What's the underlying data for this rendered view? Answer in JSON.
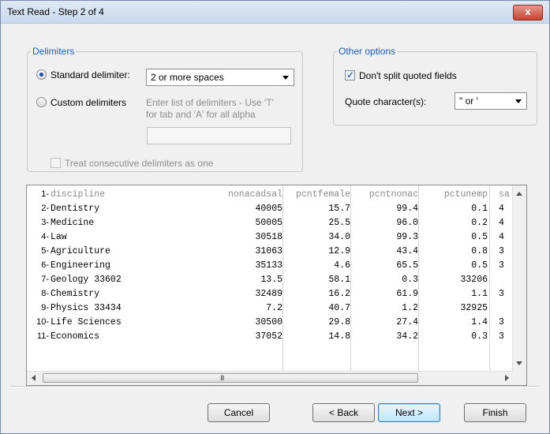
{
  "window": {
    "title": "Text Read - Step 2 of 4",
    "close_label": "x"
  },
  "delimiters": {
    "legend": "Delimiters",
    "standard_label": "Standard delimiter:",
    "standard_value": "2 or more spaces",
    "custom_label": "Custom delimiters",
    "custom_hint_line1": "Enter list of delimiters - Use 'T'",
    "custom_hint_line2": "for tab and 'A' for all alpha",
    "custom_value": "",
    "consecutive_label": "Treat consecutive delimiters as one"
  },
  "other_options": {
    "legend": "Other options",
    "dont_split_label": "Don't split quoted fields",
    "quote_label": "Quote character(s):",
    "quote_value": "\" or '"
  },
  "preview": {
    "row_numbers": [
      "1",
      "2",
      "3",
      "4",
      "5",
      "6",
      "7",
      "8",
      "9",
      "10",
      "11"
    ],
    "rows": [
      [
        "discipline",
        "nonacadsal",
        "pcntfemale",
        "pcntnonac",
        "pctunemp",
        "sa"
      ],
      [
        "Dentistry",
        "40005",
        "15.7",
        "99.4",
        "0.1",
        "4"
      ],
      [
        "Medicine",
        "50005",
        "25.5",
        "96.0",
        "0.2",
        "4"
      ],
      [
        "Law",
        "30518",
        "34.0",
        "99.3",
        "0.5",
        "4"
      ],
      [
        "Agriculture",
        "31063",
        "12.9",
        "43.4",
        "0.8",
        "3"
      ],
      [
        "Engineering",
        "35133",
        "4.6",
        "65.5",
        "0.5",
        "3"
      ],
      [
        "Geology 33602",
        "13.5",
        "58.1",
        "0.3",
        "33206",
        ""
      ],
      [
        "Chemistry",
        "32489",
        "16.2",
        "61.9",
        "1.1",
        "3"
      ],
      [
        "Physics 33434",
        "7.2",
        "40.7",
        "1.2",
        "32925",
        ""
      ],
      [
        "Life Sciences",
        "30500",
        "29.8",
        "27.4",
        "1.4",
        "3"
      ],
      [
        "Economics",
        "37052",
        "14.8",
        "34.2",
        "0.3",
        "3"
      ]
    ],
    "hscroll_grip": "III"
  },
  "buttons": {
    "cancel": "Cancel",
    "back": "< Back",
    "next": "Next >",
    "finish": "Finish"
  }
}
